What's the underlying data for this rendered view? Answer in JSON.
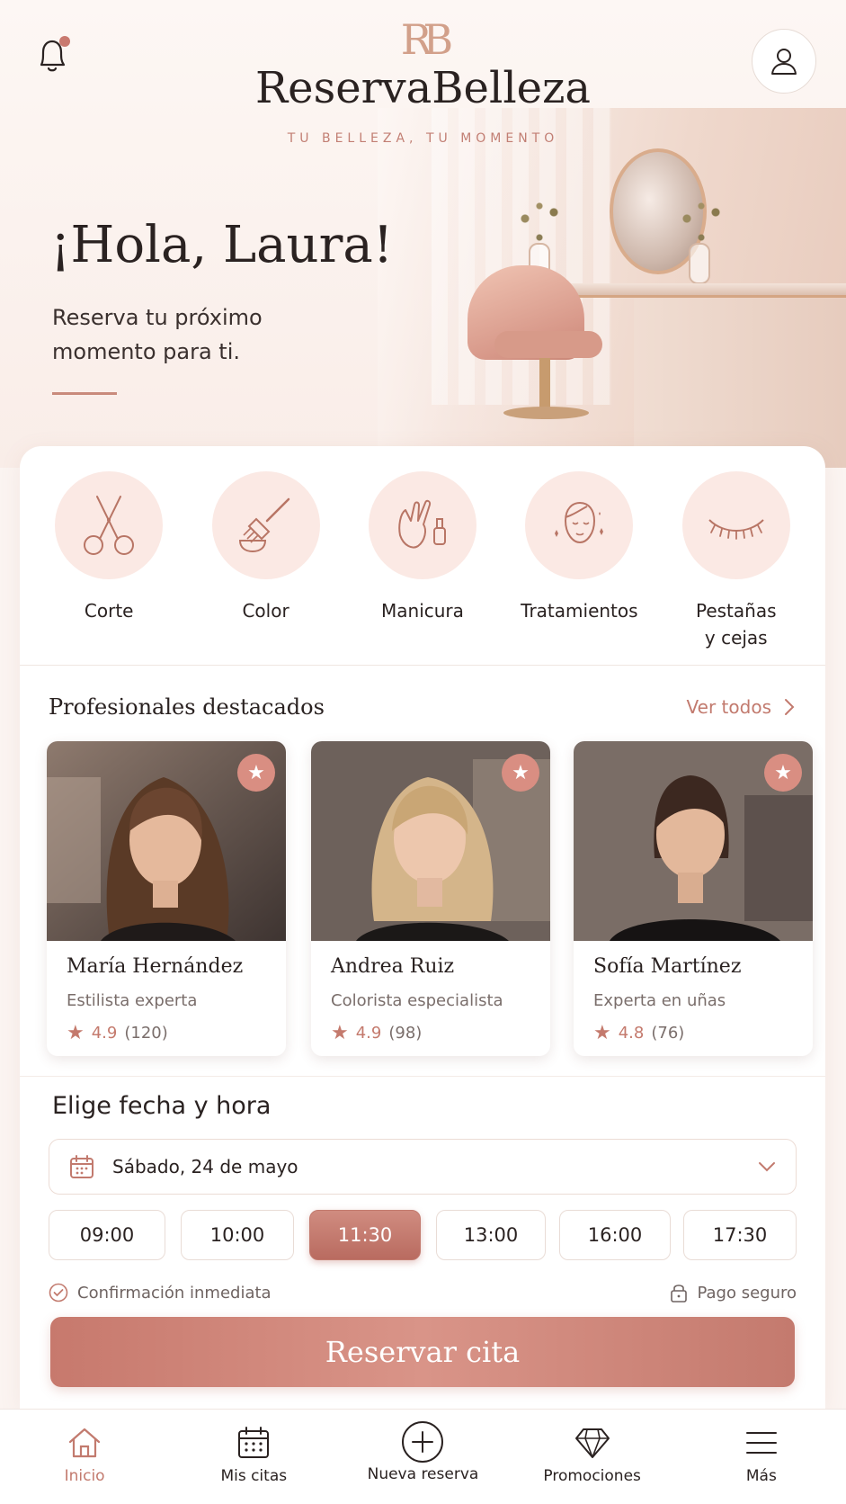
{
  "header": {
    "logo_mark": "RB",
    "brand": "ReservaBelleza",
    "tagline": "TU BELLEZA, TU MOMENTO",
    "notification_icon": "bell-icon",
    "profile_icon": "user-icon"
  },
  "hero": {
    "greeting": "¡Hola, Laura!",
    "subtitle": "Reserva tu próximo momento para ti."
  },
  "services": [
    {
      "label": "Corte",
      "icon": "scissors-icon"
    },
    {
      "label": "Color",
      "icon": "hair-dye-brush-icon"
    },
    {
      "label": "Manicura",
      "icon": "manicure-hand-icon"
    },
    {
      "label": "Tratamientos",
      "icon": "face-treatment-icon"
    },
    {
      "label": "Pestañas\ny cejas",
      "icon": "eyelash-icon"
    }
  ],
  "professionals": {
    "title": "Profesionales destacados",
    "see_all": "Ver todos",
    "items": [
      {
        "name": "María Hernández",
        "role": "Estilista experta",
        "rating": "4.9",
        "reviews": "(120)"
      },
      {
        "name": "Andrea Ruiz",
        "role": "Colorista especialista",
        "rating": "4.9",
        "reviews": "(98)"
      },
      {
        "name": "Sofía Martínez",
        "role": "Experta en uñas",
        "rating": "4.8",
        "reviews": "(76)"
      }
    ]
  },
  "booking": {
    "title": "Elige fecha y hora",
    "date_value": "Sábado, 24 de mayo",
    "times": [
      "09:00",
      "10:00",
      "11:30",
      "13:00",
      "16:00",
      "17:30"
    ],
    "selected_time": "11:30",
    "confirmation": "Confirmación inmediata",
    "secure_payment": "Pago seguro",
    "cta": "Reservar cita"
  },
  "bottom_nav": [
    {
      "label": "Inicio",
      "icon": "home-icon",
      "active": true
    },
    {
      "label": "Mis citas",
      "icon": "calendar-icon",
      "active": false
    },
    {
      "label": "Nueva reserva",
      "icon": "plus-circle-icon",
      "active": false
    },
    {
      "label": "Promociones",
      "icon": "diamond-icon",
      "active": false
    },
    {
      "label": "Más",
      "icon": "menu-icon",
      "active": false
    }
  ],
  "colors": {
    "accent": "#c27a6e",
    "accent_light": "#fbe9e4",
    "background": "#fbf4f1",
    "text": "#2a2221"
  }
}
